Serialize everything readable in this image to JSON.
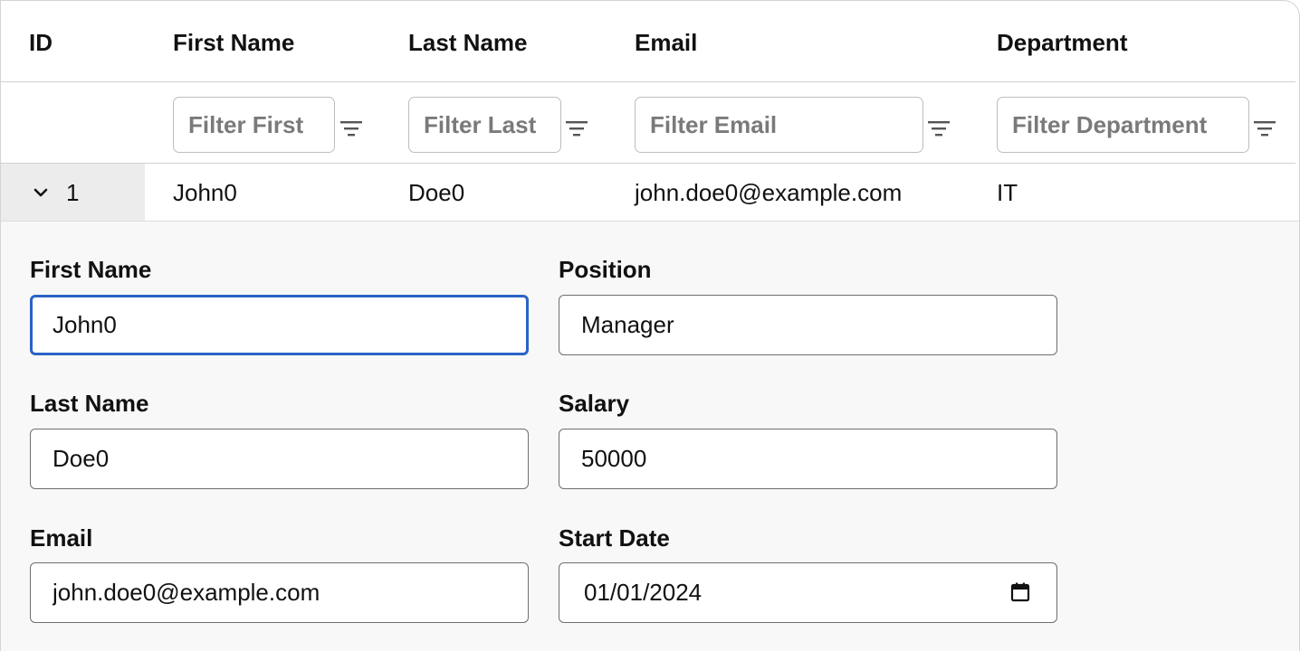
{
  "columns": {
    "id": "ID",
    "first_name": "First Name",
    "last_name": "Last Name",
    "email": "Email",
    "department": "Department"
  },
  "filters": {
    "first_placeholder": "Filter First",
    "last_placeholder": "Filter Last",
    "email_placeholder": "Filter Email",
    "department_placeholder": "Filter Department"
  },
  "row": {
    "id": "1",
    "first_name": "John0",
    "last_name": "Doe0",
    "email": "john.doe0@example.com",
    "department": "IT",
    "expanded_icon": "chevron-down-icon"
  },
  "detail": {
    "first_name_label": "First Name",
    "first_name_value": "John0",
    "last_name_label": "Last Name",
    "last_name_value": "Doe0",
    "email_label": "Email",
    "email_value": "john.doe0@example.com",
    "position_label": "Position",
    "position_value": "Manager",
    "salary_label": "Salary",
    "salary_value": "50000",
    "start_date_label": "Start Date",
    "start_date_value": "01/01/2024"
  },
  "icons": {
    "filter": "filter-icon",
    "calendar": "calendar-icon"
  },
  "colors": {
    "focus_border": "#2b63c6",
    "id_cell_bg": "#ececec",
    "detail_bg": "#f8f8f8"
  }
}
